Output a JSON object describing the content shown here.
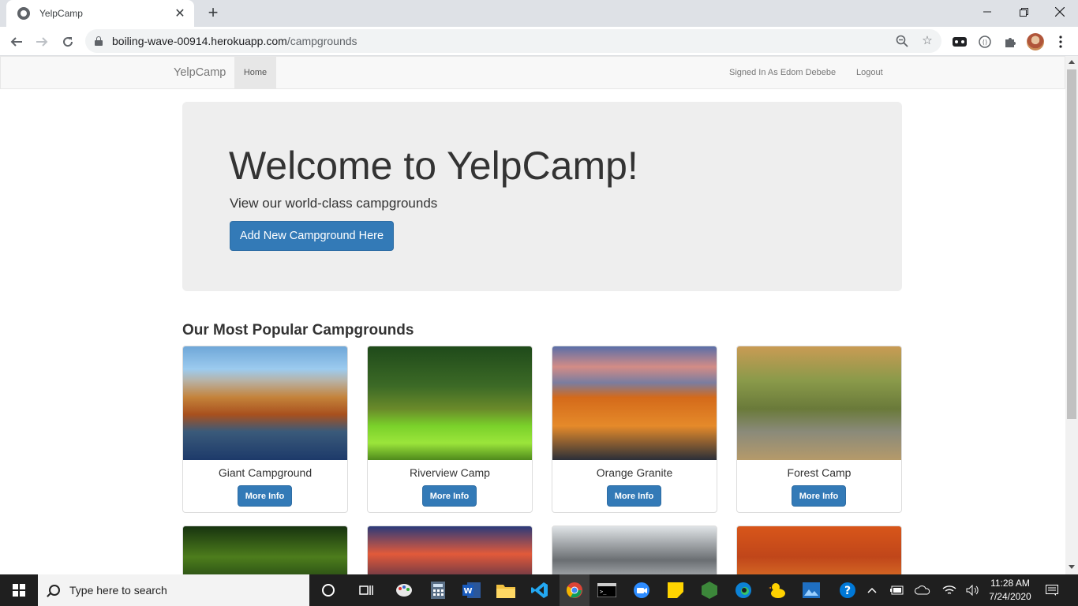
{
  "browser": {
    "tab_title": "YelpCamp",
    "url_host": "boiling-wave-00914.herokuapp.com",
    "url_path": "/campgrounds"
  },
  "navbar": {
    "brand": "YelpCamp",
    "home": "Home",
    "signed_in": "Signed In As Edom Debebe",
    "logout": "Logout"
  },
  "jumbotron": {
    "title": "Welcome to YelpCamp!",
    "subtitle": "View our world-class campgrounds",
    "button": "Add New Campground Here"
  },
  "section_title": "Our Most Popular Campgrounds",
  "campgrounds": [
    {
      "name": "Giant Campground",
      "button": "More Info"
    },
    {
      "name": "Riverview Camp",
      "button": "More Info"
    },
    {
      "name": "Orange Granite",
      "button": "More Info"
    },
    {
      "name": "Forest Camp",
      "button": "More Info"
    }
  ],
  "taskbar": {
    "search_placeholder": "Type here to search",
    "time": "11:28 AM",
    "date": "7/24/2020"
  }
}
